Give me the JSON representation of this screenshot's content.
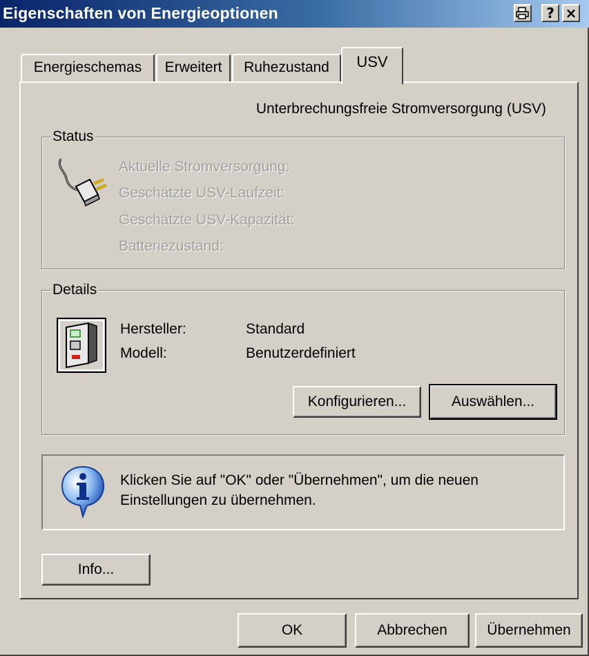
{
  "window": {
    "title": "Eigenschaften von Energieoptionen",
    "controls": {
      "help": "?",
      "close": "×"
    }
  },
  "tabs": [
    {
      "label": "Energieschemas",
      "active": false
    },
    {
      "label": "Erweitert",
      "active": false
    },
    {
      "label": "Ruhezustand",
      "active": false
    },
    {
      "label": "USV",
      "active": true
    }
  ],
  "usv": {
    "heading": "Unterbrechungsfreie Stromversorgung (USV)",
    "status": {
      "legend": "Status",
      "icon": "power-plug-icon",
      "items": [
        "Aktuelle Stromversorgung:",
        "Geschätzte USV-Laufzeit:",
        "Geschätzte USV-Kapazität:",
        "Batteriezustand:"
      ]
    },
    "details": {
      "legend": "Details",
      "icon": "ups-device-icon",
      "manufacturer_label": "Hersteller:",
      "manufacturer_value": "Standard",
      "model_label": "Modell:",
      "model_value": "Benutzerdefiniert",
      "configure_button": "Konfigurieren...",
      "select_button": "Auswählen..."
    },
    "info": {
      "icon": "info-icon",
      "line1": "Klicken Sie auf \"OK\" oder \"Übernehmen\", um die neuen",
      "line2": "Einstellungen zu übernehmen."
    },
    "info_button": "Info..."
  },
  "footer": {
    "ok": "OK",
    "cancel": "Abbrechen",
    "apply": "Übernehmen"
  },
  "colors": {
    "titlebar_start": "#0a246a",
    "titlebar_end": "#a6caf0",
    "face": "#d4d0c8",
    "disabled_text": "#a0a0a0"
  }
}
